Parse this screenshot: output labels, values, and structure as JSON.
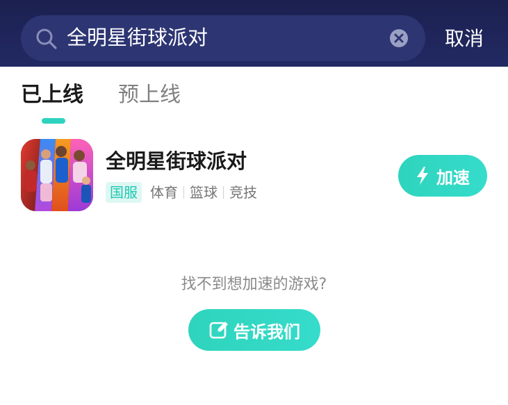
{
  "search": {
    "query": "全明星街球派对",
    "cancel_label": "取消"
  },
  "tabs": [
    {
      "label": "已上线",
      "active": true
    },
    {
      "label": "预上线",
      "active": false
    }
  ],
  "game": {
    "title": "全明星街球派对",
    "region_badge": "国服",
    "tags": [
      "体育",
      "篮球",
      "竞技"
    ],
    "action_label": "加速"
  },
  "empty_hint": {
    "text": "找不到想加速的游戏?",
    "button_label": "告诉我们"
  },
  "colors": {
    "header_bg": "#1c2050",
    "accent": "#2ed3c0",
    "badge_bg": "#dff7f3"
  }
}
